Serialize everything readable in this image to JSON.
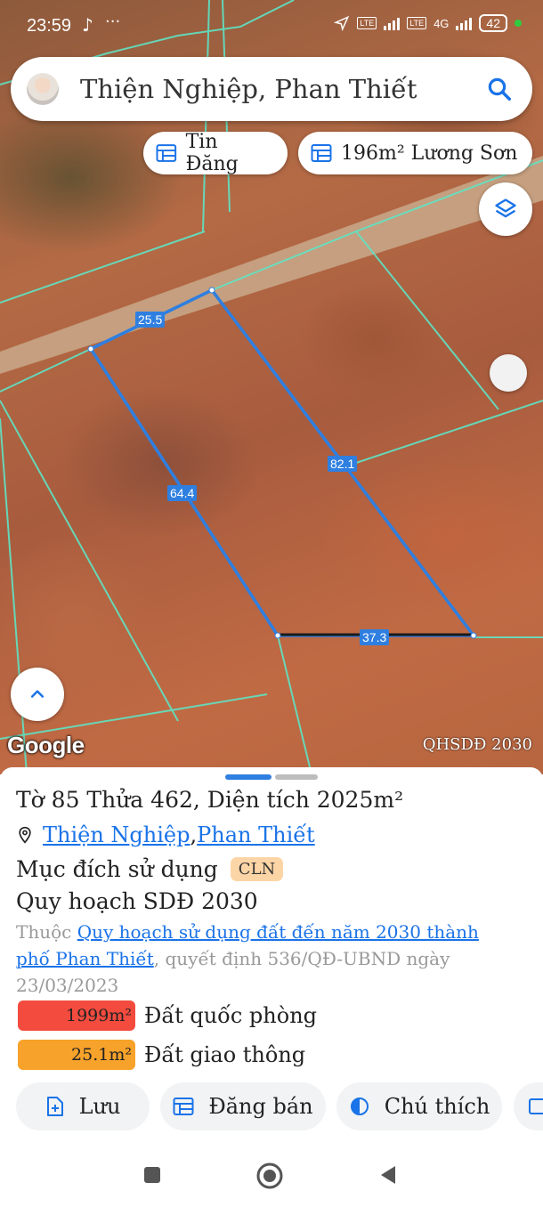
{
  "status_bar": {
    "time": "23:59",
    "dots": "···",
    "battery": "42",
    "lte": "LTE",
    "network": "4G"
  },
  "search": {
    "query": "Thiện Nghiệp, Phan Thiết"
  },
  "chips": {
    "tin_dang": "Tin Đăng",
    "listing": "196m² Lương Sơn"
  },
  "map": {
    "edges": {
      "top": "25.5",
      "right": "82.1",
      "left": "64.4",
      "bottom": "37.3"
    },
    "attribution": "Google",
    "layer_label": "QHSDĐ 2030"
  },
  "parcel": {
    "title": "Tờ 85 Thửa 462, Diện tích 2025m²",
    "ward": "Thiện Nghiệp",
    "separator": ", ",
    "city": "Phan Thiết",
    "purpose_label": "Mục đích sử dụng",
    "purpose_code": "CLN",
    "plan_title": "Quy hoạch SDĐ 2030",
    "desc_prefix": "Thuộc ",
    "desc_link": "Quy hoạch sử dụng đất đến năm 2030 thành phố Phan Thiết",
    "desc_suffix": ", quyết định 536/QĐ-UBND ngày 23/03/2023",
    "zones": [
      {
        "area": "1999m²",
        "name": "Đất quốc phòng",
        "color": "#f44b3f"
      },
      {
        "area": "25.1m²",
        "name": "Đất giao thông",
        "color": "#f7a22a"
      }
    ]
  },
  "actions": {
    "save": "Lưu",
    "post": "Đăng bán",
    "legend": "Chú thích"
  },
  "colors": {
    "accent": "#1a73e8",
    "boundary": "#2f7fe0",
    "cadastral": "#5fe3c4",
    "handle_active": "#2f7fe0",
    "handle_inactive": "#bdbdbd"
  },
  "icons": {
    "search": "search-icon",
    "layers": "layers-icon",
    "table": "table-icon",
    "expand": "chevron-up-icon",
    "location": "location-pin-icon",
    "save": "file-plus-icon",
    "legend": "half-circle-icon"
  }
}
